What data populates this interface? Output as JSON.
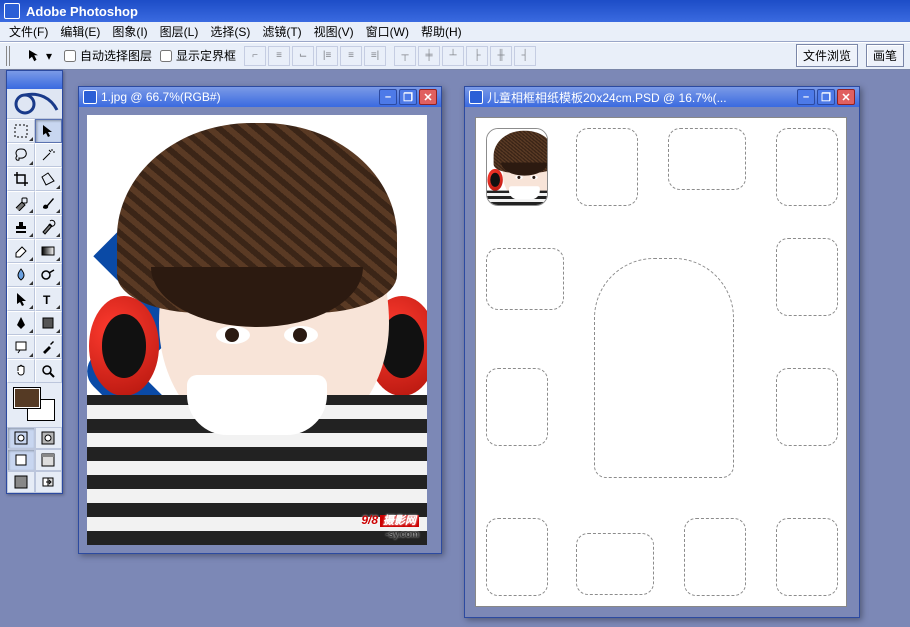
{
  "app": {
    "title": "Adobe Photoshop"
  },
  "menu": {
    "items": [
      "文件(F)",
      "编辑(E)",
      "图象(I)",
      "图层(L)",
      "选择(S)",
      "滤镜(T)",
      "视图(V)",
      "窗口(W)",
      "帮助(H)"
    ]
  },
  "options_bar": {
    "auto_select_label": "自动选择图层",
    "show_bbox_label": "显示定界框",
    "btn_file_browse": "文件浏览",
    "btn_brush": "画笔"
  },
  "toolbox": {
    "tools": [
      "marquee",
      "move",
      "lasso",
      "magic-wand",
      "crop",
      "slice",
      "healing",
      "brush",
      "stamp",
      "history-brush",
      "eraser",
      "gradient",
      "blur",
      "dodge",
      "path-select",
      "type",
      "pen",
      "shape",
      "notes",
      "eyedropper",
      "hand",
      "zoom"
    ],
    "fg_color": "#553a24",
    "bg_color": "#ffffff"
  },
  "documents": {
    "doc1": {
      "title": "1.jpg @ 66.7%(RGB#)",
      "watermark_main": "9/8",
      "watermark_tag": "摄影网",
      "watermark_sub": "-sy.com"
    },
    "doc2": {
      "title": "儿童相框相纸模板20x24cm.PSD @ 16.7%(..."
    }
  },
  "window_buttons": {
    "min": "–",
    "max": "❐",
    "close": "✕"
  }
}
